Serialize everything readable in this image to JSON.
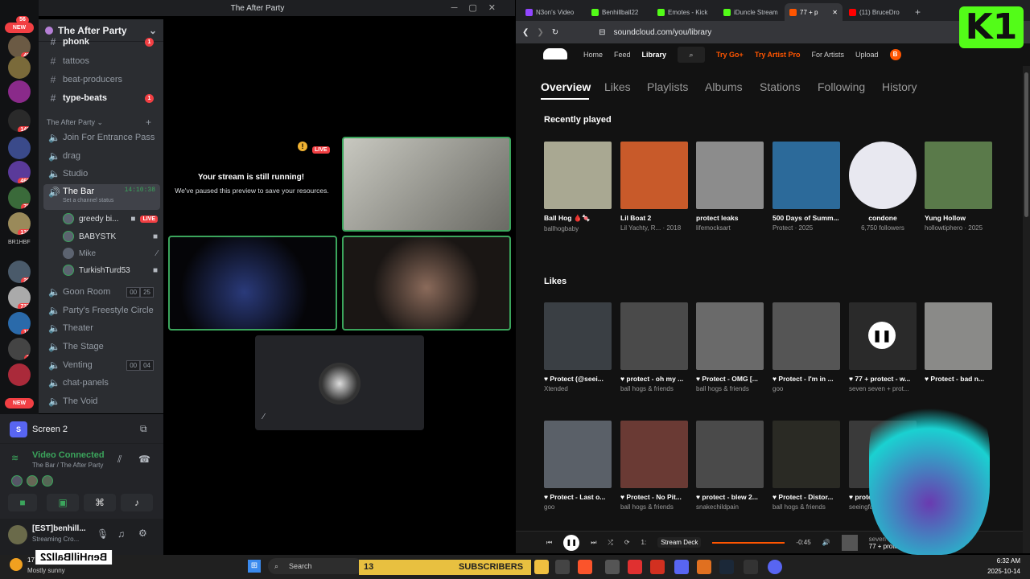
{
  "window_title": "The After Party",
  "rail": {
    "badges": [
      "56",
      "49",
      "148",
      "468",
      "70",
      "138",
      "2",
      "29",
      "737",
      "16",
      "7"
    ],
    "new_label": "NEW",
    "server_label": "BR1HBF"
  },
  "server": {
    "name": "The After Party"
  },
  "channels": {
    "top": [
      {
        "name": "phonk",
        "badge": "1"
      },
      {
        "name": "tattoos"
      },
      {
        "name": "beat-producers"
      },
      {
        "name": "type-beats",
        "badge": "1"
      }
    ],
    "category": "The After Party",
    "voice": [
      {
        "name": "Join For Entrance Pass"
      },
      {
        "name": "drag"
      },
      {
        "name": "Studio"
      }
    ],
    "selected": {
      "name": "The Bar",
      "timer": "14:10:38",
      "status": "Set a channel status"
    },
    "users": [
      {
        "name": "greedy bi...",
        "live": "LIVE"
      },
      {
        "name": "BABYSTK"
      },
      {
        "name": "Mike"
      },
      {
        "name": "TurkishTurd53"
      }
    ],
    "more": [
      {
        "name": "Goon Room",
        "c1": "00",
        "c2": "25"
      },
      {
        "name": "Party's Freestyle Circle"
      },
      {
        "name": "Theater"
      },
      {
        "name": "The Stage"
      },
      {
        "name": "Venting",
        "c1": "00",
        "c2": "04"
      },
      {
        "name": "chat-panels"
      },
      {
        "name": "The Void"
      }
    ]
  },
  "panel": {
    "screen": "Screen 2",
    "connected": "Video Connected",
    "location": "The Bar / The After Party",
    "user": "[EST]benhill...",
    "user_status": "Streaming Cro..."
  },
  "stage": {
    "live": "LIVE",
    "notice_title": "Your stream is still running!",
    "notice_body": "We've paused this preview to save your resources."
  },
  "browser": {
    "tabs": [
      "N3on's Video",
      "Benhillball22",
      "Emotes - Kick",
      "iDuncle Stream",
      "77 + p",
      "(11) BruceDro"
    ],
    "url": "soundcloud.com/you/library"
  },
  "soundcloud": {
    "nav": [
      "Home",
      "Feed",
      "Library",
      "Try Go+",
      "Try Artist Pro",
      "For Artists",
      "Upload"
    ],
    "subtabs": [
      "Overview",
      "Likes",
      "Playlists",
      "Albums",
      "Stations",
      "Following",
      "History"
    ],
    "recent_title": "Recently played",
    "likes_title": "Likes",
    "recent": [
      {
        "t": "Ball Hog 🩸🍬",
        "s": "ballhogbaby",
        "c": "#a9a892"
      },
      {
        "t": "Lil Boat 2",
        "s": "Lil Yachty, R... · 2018",
        "c": "#c85a2a"
      },
      {
        "t": "protect leaks",
        "s": "lifemocksart",
        "c": "#8c8c8c"
      },
      {
        "t": "500 Days of Summ...",
        "s": "Protect · 2025",
        "c": "#2c6a9a"
      },
      {
        "t": "condone",
        "s": "6,750 followers",
        "c": "#e8e8f0"
      },
      {
        "t": "Yung Hollow",
        "s": "hollowtiphero · 2025",
        "c": "#5a7a4a"
      }
    ],
    "likes": [
      {
        "t": "♥ Protect (@seei...",
        "s": "Xtended",
        "c": "#3a3f44"
      },
      {
        "t": "♥ protect - oh my ...",
        "s": "ball hogs & friends",
        "c": "#4a4a4a"
      },
      {
        "t": "♥ Protect - OMG [...",
        "s": "ball hogs & friends",
        "c": "#6a6a6a"
      },
      {
        "t": "♥ Protect - I'm in ...",
        "s": "goo",
        "c": "#555"
      },
      {
        "t": "♥ 77 + protect - w...",
        "s": "seven seven + prot...",
        "c": "#2a2a2a"
      },
      {
        "t": "♥ Protect - bad n...",
        "s": "",
        "c": "#8a8a88"
      }
    ],
    "likes2": [
      {
        "t": "♥ Protect - Last o...",
        "s": "goo",
        "c": "#5a6068"
      },
      {
        "t": "♥ Protect - No Pit...",
        "s": "ball hogs & friends",
        "c": "#6a3a34"
      },
      {
        "t": "♥ protect - blew 2...",
        "s": "snakechildpain",
        "c": "#4a4a4a"
      },
      {
        "t": "♥ Protect - Distor...",
        "s": "ball hogs & friends",
        "c": "#2a2a24"
      },
      {
        "t": "♥ protect",
        "s": "seeingfa...",
        "c": "#3a3a3a"
      }
    ],
    "player": {
      "tooltip": "Stream Deck",
      "speed": "1:",
      "time": "-0:45",
      "artist": "seven sev...",
      "track": "77 + protect"
    }
  },
  "taskbar": {
    "weather_temp": "17",
    "weather": "Mostly sunny",
    "search": "Search",
    "subs": "13",
    "subs_label": "SUBSCRIBERS",
    "time": "6:32 AM",
    "date": "2025-10-14",
    "channel_overlay": "BenHillBall22"
  }
}
